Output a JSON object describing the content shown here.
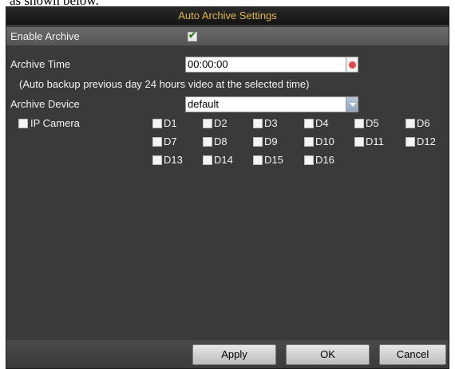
{
  "page_fragment": "as shown below.",
  "dialog": {
    "title": "Auto Archive Settings"
  },
  "enable_archive": {
    "label": "Enable Archive",
    "checked": true
  },
  "archive_time": {
    "label": "Archive Time",
    "value": "00:00:00",
    "note": "(Auto backup previous day 24 hours video at the selected time)"
  },
  "archive_device": {
    "label": "Archive Device",
    "value": "default"
  },
  "ip_camera": {
    "label": "IP Camera",
    "checked": false,
    "channels": [
      "D1",
      "D2",
      "D3",
      "D4",
      "D5",
      "D6",
      "D7",
      "D8",
      "D9",
      "D10",
      "D11",
      "D12",
      "D13",
      "D14",
      "D15",
      "D16"
    ]
  },
  "buttons": {
    "apply": "Apply",
    "ok": "OK",
    "cancel": "Cancel"
  },
  "colors": {
    "title_text": "#e0b64a",
    "panel_bg": "#3a3a3a",
    "label_text": "#f2f2f2"
  }
}
